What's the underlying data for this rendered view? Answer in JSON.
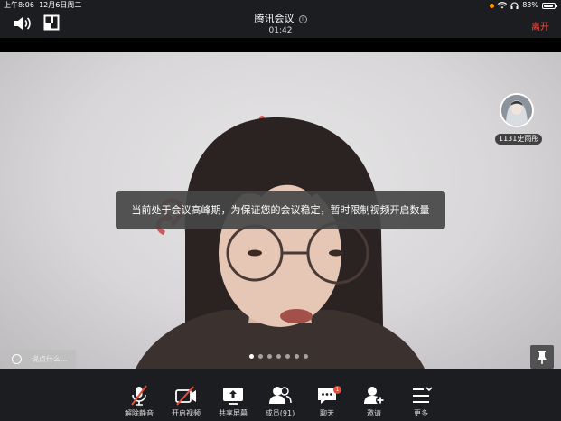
{
  "status_bar": {
    "time": "上午8:06",
    "date": "12月6日周二",
    "battery": "83%"
  },
  "header": {
    "title": "腾讯会议",
    "timer": "01:42",
    "leave_label": "离开",
    "info_icon_glyph": "i"
  },
  "video": {
    "participant_tile": {
      "name": "1131史雨彤"
    },
    "toast": "当前处于会议高峰期，为保证您的会议稳定，暂时限制视频开启数量",
    "chat_placeholder": "说点什么...",
    "page_count": 7,
    "active_page": 1
  },
  "toolbar": {
    "unmute": "解除静音",
    "start_video": "开启视频",
    "share_screen": "共享屏幕",
    "members": "成员(91)",
    "chat": "聊天",
    "chat_badge": "1",
    "invite": "邀请",
    "more": "更多"
  },
  "colors": {
    "leave": "#ff4b3e",
    "mute_slash": "#e94b3c",
    "badge": "#e94b3c",
    "bar_bg": "#1c1d20"
  }
}
